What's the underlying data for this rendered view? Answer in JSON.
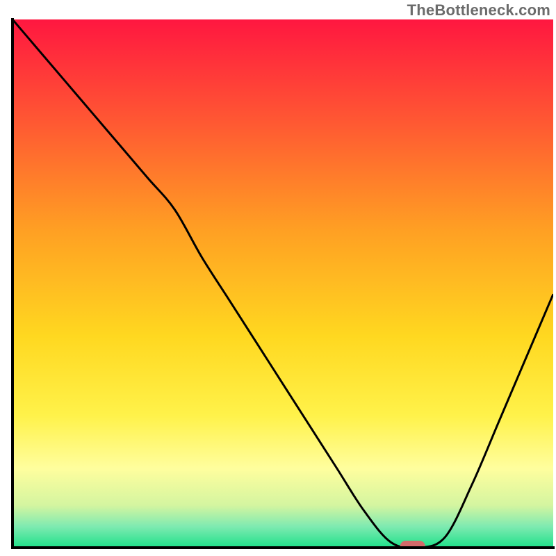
{
  "watermark": "TheBottleneck.com",
  "chart_data": {
    "type": "line",
    "title": "",
    "xlabel": "",
    "ylabel": "",
    "xlim": [
      0,
      100
    ],
    "ylim": [
      0,
      100
    ],
    "x": [
      0,
      5,
      10,
      15,
      20,
      25,
      30,
      35,
      40,
      45,
      50,
      55,
      60,
      65,
      70,
      75,
      80,
      85,
      90,
      95,
      100
    ],
    "values": [
      100,
      94,
      88,
      82,
      76,
      70,
      64,
      55,
      47,
      39,
      31,
      23,
      15,
      7,
      1,
      0,
      2,
      12,
      24,
      36,
      48
    ],
    "marker": {
      "x": 74,
      "y": 0,
      "color": "#d46a6a"
    },
    "gradient_stops": [
      {
        "offset": 0.0,
        "color": "#ff1740"
      },
      {
        "offset": 0.2,
        "color": "#ff5a32"
      },
      {
        "offset": 0.4,
        "color": "#ffa023"
      },
      {
        "offset": 0.6,
        "color": "#ffd820"
      },
      {
        "offset": 0.75,
        "color": "#fff24a"
      },
      {
        "offset": 0.85,
        "color": "#fffe9e"
      },
      {
        "offset": 0.92,
        "color": "#d4f5a0"
      },
      {
        "offset": 0.96,
        "color": "#7eeab1"
      },
      {
        "offset": 1.0,
        "color": "#1fe08a"
      }
    ],
    "axis_color": "#000000",
    "curve_color": "#000000"
  }
}
